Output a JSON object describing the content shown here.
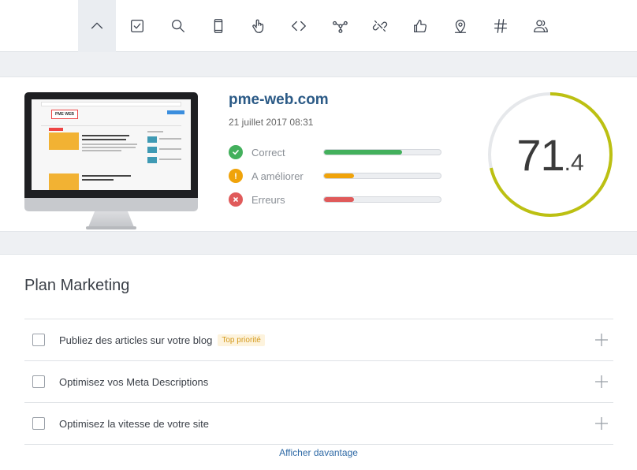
{
  "toolbar": {
    "items": [
      {
        "icon": "chevron-up-icon",
        "active": true
      },
      {
        "icon": "checkbox-icon"
      },
      {
        "icon": "search-icon"
      },
      {
        "icon": "mobile-icon"
      },
      {
        "icon": "pointer-hand-icon"
      },
      {
        "icon": "code-icon"
      },
      {
        "icon": "network-icon"
      },
      {
        "icon": "link-broken-icon"
      },
      {
        "icon": "thumbs-up-icon"
      },
      {
        "icon": "location-pin-icon"
      },
      {
        "icon": "hashtag-icon"
      },
      {
        "icon": "users-icon"
      }
    ]
  },
  "summary": {
    "site_name": "pme-web.com",
    "date": "21 juillet 2017 08:31",
    "thumbnail_logo": "PME WEB",
    "stats": [
      {
        "label": "Correct",
        "status": "success",
        "color": "#43b05c",
        "fill": 0.67
      },
      {
        "label": "A améliorer",
        "status": "warning",
        "color": "#f0a30a",
        "fill": 0.26
      },
      {
        "label": "Erreurs",
        "status": "error",
        "color": "#e05a5a",
        "fill": 0.26
      }
    ],
    "score": {
      "integer": "71",
      "decimal": ".4",
      "value": 71.4,
      "ring_color": "#bcc012",
      "track_color": "#e6e8eb"
    }
  },
  "plan": {
    "title": "Plan Marketing",
    "tasks": [
      {
        "label": "Publiez des articles sur votre blog",
        "badge": "Top priorité"
      },
      {
        "label": "Optimisez vos Meta Descriptions",
        "badge": ""
      },
      {
        "label": "Optimisez la vitesse de votre site",
        "badge": ""
      }
    ],
    "more_label": "Afficher davantage"
  }
}
